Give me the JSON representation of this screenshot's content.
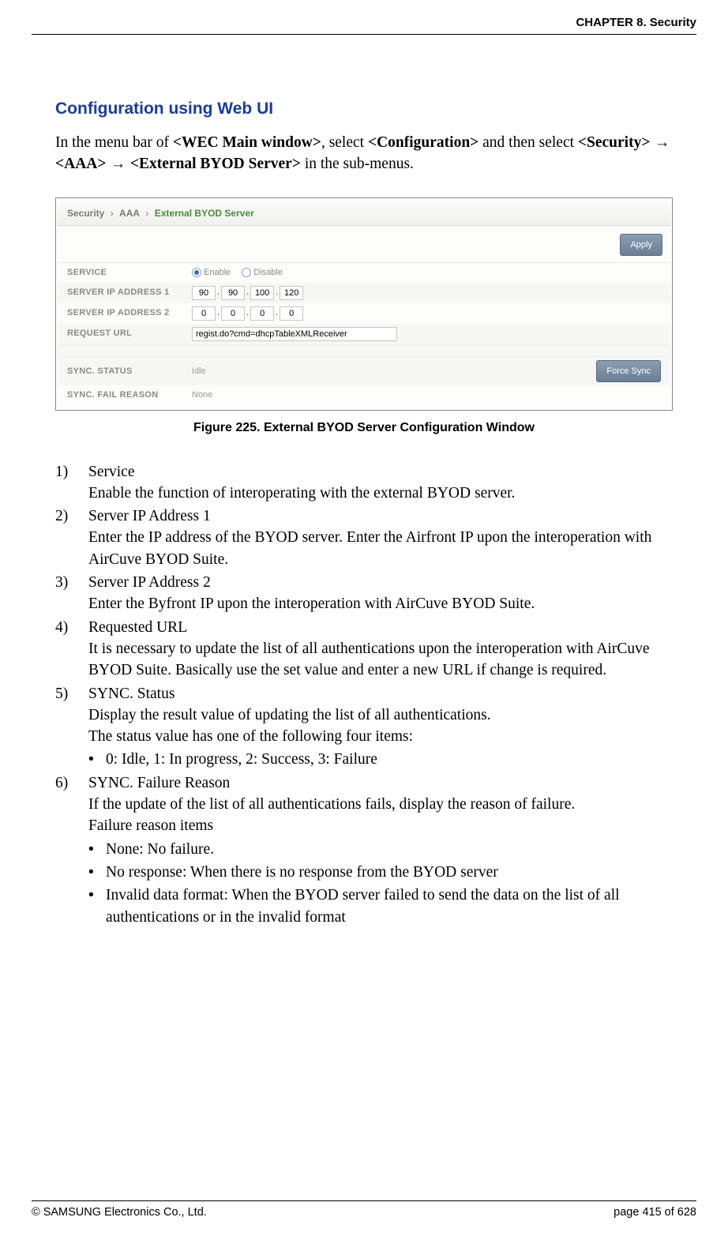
{
  "header": "CHAPTER 8. Security",
  "section_title": "Configuration using Web UI",
  "intro": {
    "t1": "In the menu bar of ",
    "b1": "<WEC Main window>",
    "t2": ", select ",
    "b2": "<Configuration>",
    "t3": " and then select ",
    "b3": "<Security>",
    "arrow1": " → ",
    "b4": "<AAA>",
    "arrow2": " → ",
    "b5": "<External BYOD Server>",
    "t4": " in the sub-menus."
  },
  "figure": {
    "breadcrumb": {
      "p1": "Security",
      "p2": "AAA",
      "p3": "External BYOD Server",
      "sep": "›"
    },
    "apply_btn": "Apply",
    "force_sync_btn": "Force Sync",
    "rows": {
      "service": {
        "label": "SERVICE",
        "enable": "Enable",
        "disable": "Disable"
      },
      "ip1": {
        "label": "SERVER IP ADDRESS 1",
        "a": "90",
        "b": "90",
        "c": "100",
        "d": "120"
      },
      "ip2": {
        "label": "SERVER IP ADDRESS 2",
        "a": "0",
        "b": "0",
        "c": "0",
        "d": "0"
      },
      "url": {
        "label": "REQUEST URL",
        "value": "regist.do?cmd=dhcpTableXMLReceiver"
      },
      "status": {
        "label": "SYNC. STATUS",
        "value": "Idle"
      },
      "fail": {
        "label": "SYNC. FAIL REASON",
        "value": "None"
      }
    },
    "caption": "Figure 225. External BYOD Server Configuration Window"
  },
  "items": [
    {
      "num": "1)",
      "title": "Service",
      "desc": [
        "Enable the function of interoperating with the external BYOD server."
      ]
    },
    {
      "num": "2)",
      "title": "Server IP Address 1",
      "desc": [
        "Enter the IP address of the BYOD server. Enter the Airfront IP upon the interoperation with AirCuve BYOD Suite."
      ]
    },
    {
      "num": "3)",
      "title": "Server IP Address 2",
      "desc": [
        "Enter the Byfront IP upon the interoperation with AirCuve BYOD Suite."
      ]
    },
    {
      "num": "4)",
      "title": "Requested URL",
      "desc": [
        "It is necessary to update the list of all authentications upon the interoperation with AirCuve BYOD Suite. Basically use the set value and enter a new URL if change is required."
      ]
    },
    {
      "num": "5)",
      "title": "SYNC. Status",
      "desc": [
        "Display the result value of updating the list of all authentications.",
        "The status value has one of the following four items:"
      ],
      "bullets": [
        "0: Idle, 1: In progress, 2: Success, 3: Failure"
      ]
    },
    {
      "num": "6)",
      "title": "SYNC. Failure Reason",
      "desc": [
        "If the update of the list of all authentications fails, display the reason of failure.",
        "Failure reason items"
      ],
      "bullets": [
        "None: No failure.",
        "No response: When there is no response from the BYOD server",
        "Invalid data format: When the BYOD server failed to send the data on the list of all authentications or in the invalid format"
      ]
    }
  ],
  "footer": {
    "left": "© SAMSUNG Electronics Co., Ltd.",
    "right": "page 415 of 628"
  }
}
